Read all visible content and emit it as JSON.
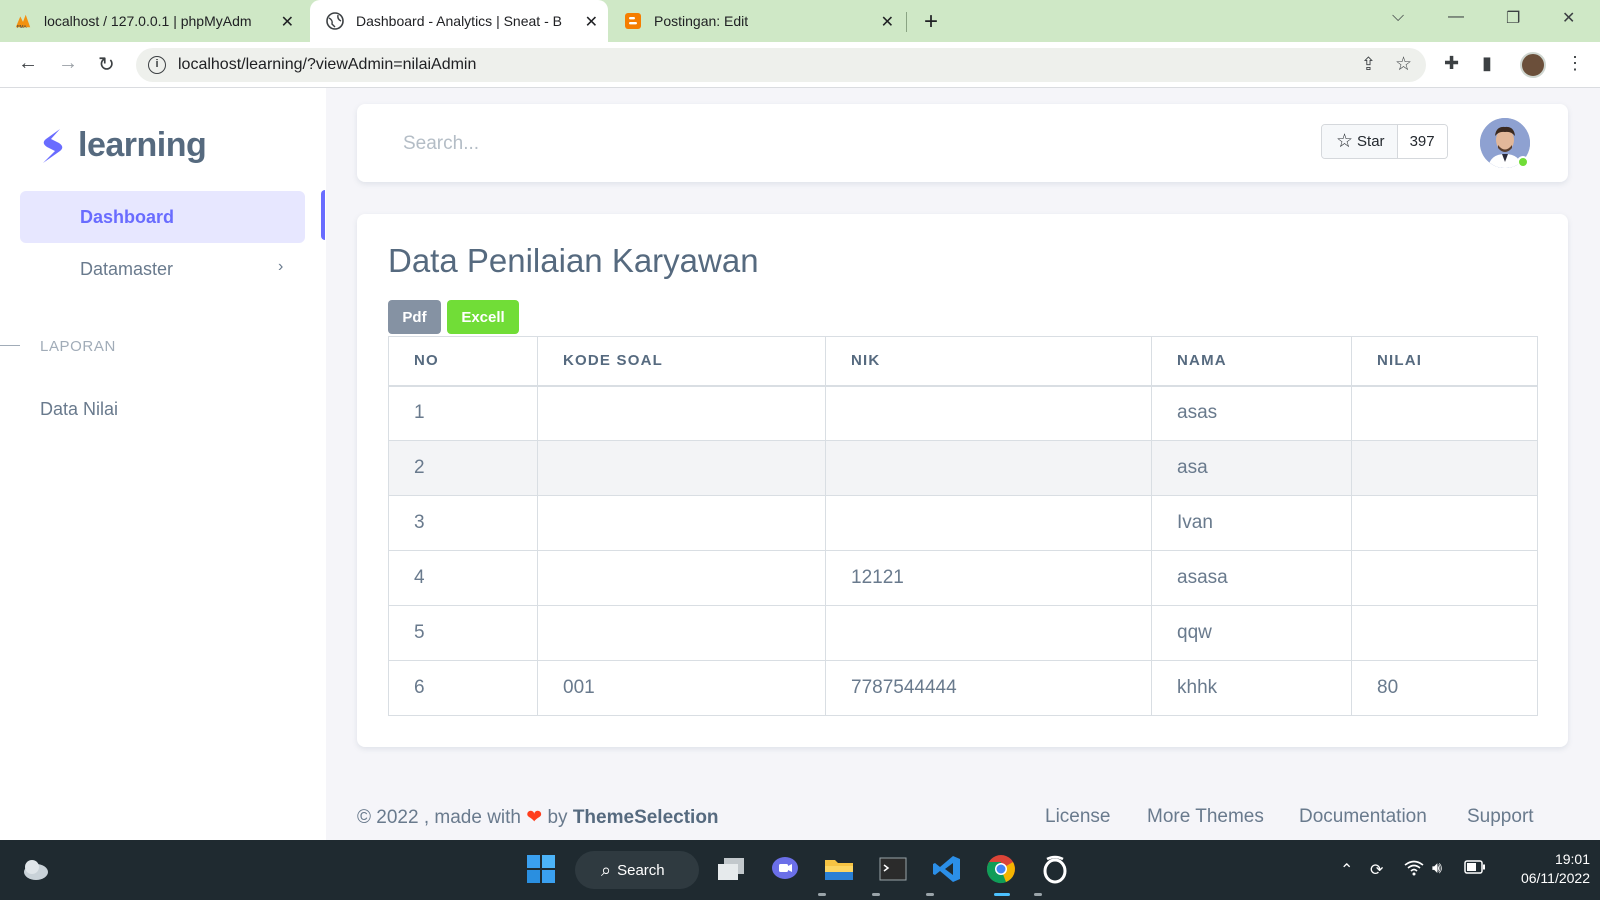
{
  "browser": {
    "tabs": [
      {
        "title": "localhost / 127.0.0.1 | phpMyAdm",
        "icon": "phpmyadmin-icon"
      },
      {
        "title": "Dashboard - Analytics | Sneat - B",
        "icon": "globe-icon"
      },
      {
        "title": "Postingan: Edit",
        "icon": "blogger-icon"
      }
    ],
    "url": "localhost/learning/?viewAdmin=nilaiAdmin"
  },
  "sidebar": {
    "brand": "learning",
    "items": [
      {
        "label": "Dashboard",
        "active": true
      },
      {
        "label": "Datamaster"
      }
    ],
    "section": "LAPORAN",
    "section_items": [
      {
        "label": "Data Nilai"
      }
    ]
  },
  "navbar": {
    "search_placeholder": "Search...",
    "star_label": "Star",
    "star_count": "397"
  },
  "main": {
    "title": "Data Penilaian Karyawan",
    "pdf_label": "Pdf",
    "excel_label": "Excell",
    "columns": [
      "NO",
      "KODE SOAL",
      "NIK",
      "NAMA",
      "NILAI"
    ],
    "rows": [
      [
        "1",
        "",
        "",
        "asas",
        ""
      ],
      [
        "2",
        "",
        "",
        "asa",
        ""
      ],
      [
        "3",
        "",
        "",
        "Ivan",
        ""
      ],
      [
        "4",
        "",
        "12121",
        "asasa",
        ""
      ],
      [
        "5",
        "",
        "",
        "qqw",
        ""
      ],
      [
        "6",
        "001",
        "7787544444",
        "khhk",
        "80"
      ]
    ]
  },
  "footer": {
    "copyright": "© 2022 , made with",
    "by": "by",
    "brand": "ThemeSelection",
    "links": [
      "License",
      "More Themes",
      "Documentation",
      "Support"
    ]
  },
  "taskbar": {
    "search_label": "Search",
    "time": "19:01",
    "date": "06/11/2022"
  },
  "colors": {
    "accent": "#696cff",
    "success": "#71dd37",
    "secondary": "#8592a3",
    "tabbar": "#cfe8c6"
  }
}
